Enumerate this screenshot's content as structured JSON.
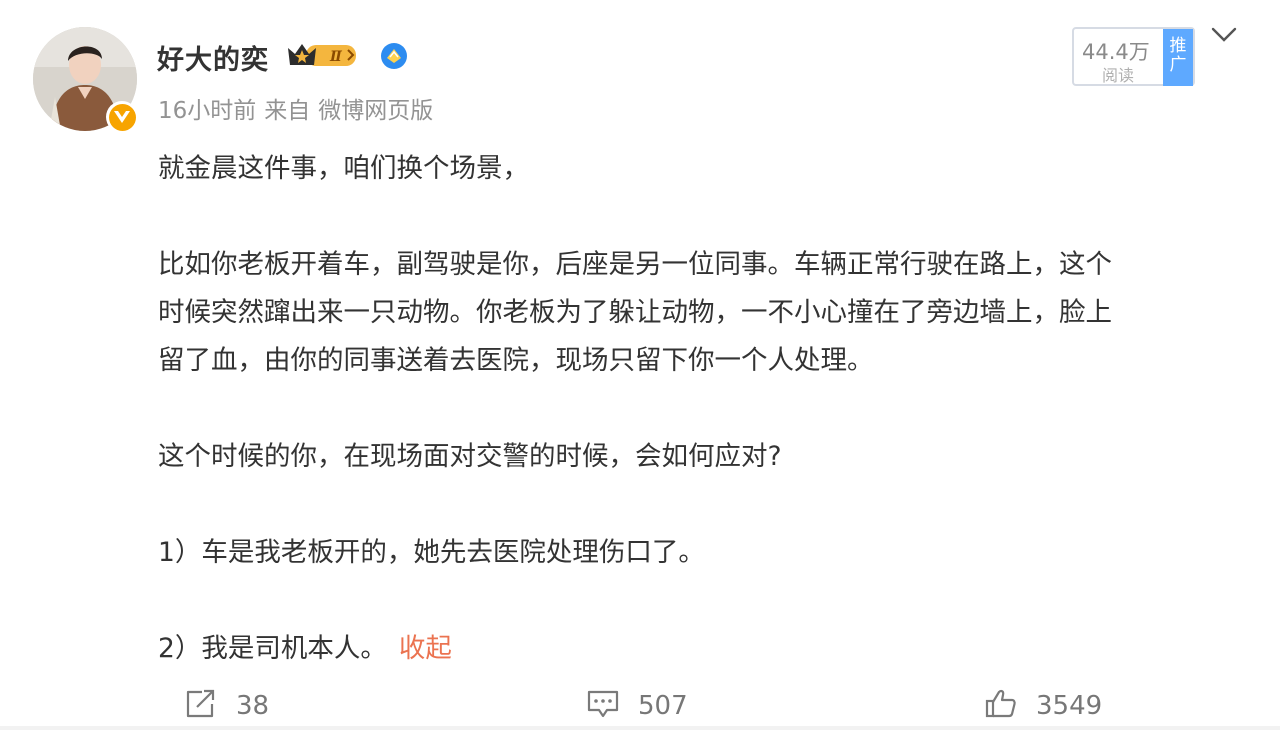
{
  "user": {
    "name": "好大的奕",
    "level_badge": "Ⅱ",
    "avatar_icon": "avatar-photo",
    "verified_badge_color": "#f7a400"
  },
  "meta": {
    "time": "16小时前",
    "source_prefix": "来自",
    "source": "微博网页版"
  },
  "stats_box": {
    "read_count": "44.4万",
    "read_label": "阅读",
    "promote_label": "推广"
  },
  "content": {
    "paragraphs": [
      [
        "就金晨这件事，咱们换个场景，"
      ],
      [
        "比如你老板开着车，副驾驶是你，后座是另一位同事。车辆正常行驶在路上，这个",
        "时候突然蹿出来一只动物。你老板为了躲让动物，一不小心撞在了旁边墙上，脸上",
        "留了血，由你的同事送着去医院，现场只留下你一个人处理。"
      ],
      [
        "这个时候的你，在现场面对交警的时候，会如何应对?"
      ],
      [
        "1）车是我老板开的，她先去医院处理伤口了。"
      ],
      [
        "2）我是司机本人。"
      ]
    ],
    "collapse_label": "收起"
  },
  "actions": {
    "repost_count": "38",
    "comment_count": "507",
    "like_count": "3549"
  },
  "colors": {
    "accent_link": "#eb7350",
    "promote_bg": "#5ea9ff",
    "verify_blue": "#2d8cf0"
  }
}
